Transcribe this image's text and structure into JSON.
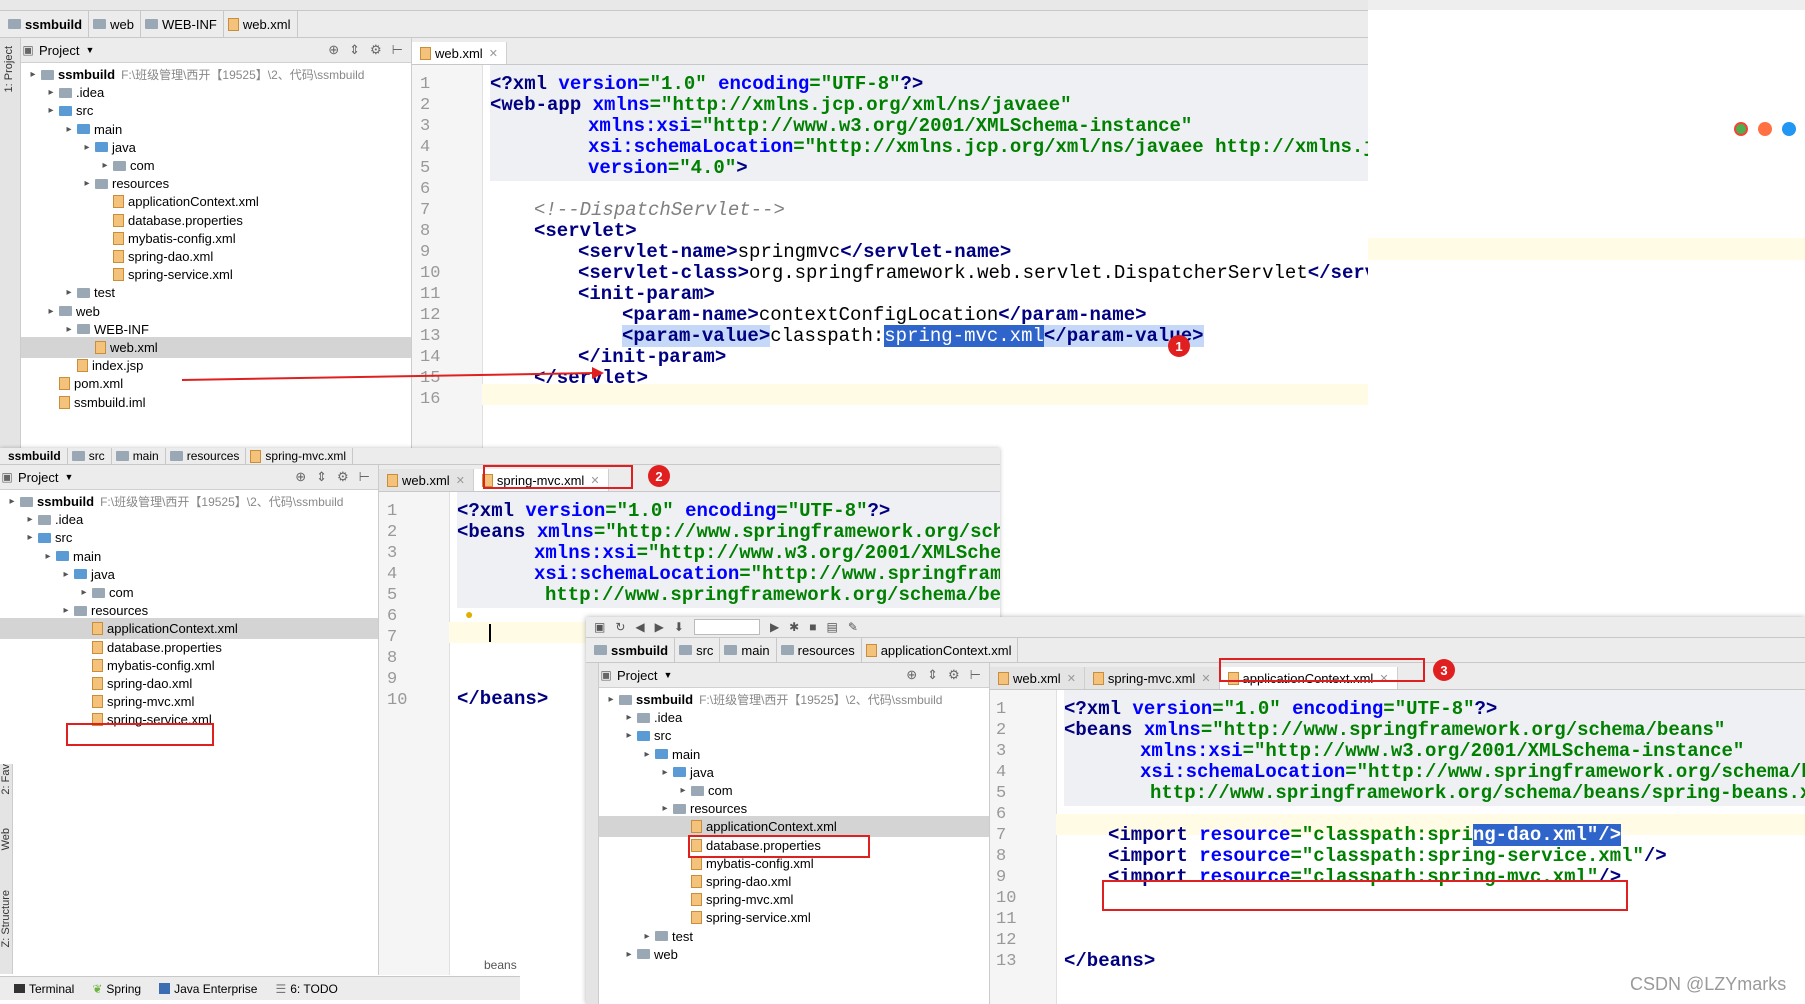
{
  "window1": {
    "breadcrumb": [
      "ssmbuild",
      "web",
      "WEB-INF",
      "web.xml"
    ],
    "project_label": "Project",
    "tree": [
      {
        "label": "ssmbuild",
        "path": "F:\\班级管理\\西开【19525】\\2、代码\\ssmbuild",
        "depth": 0
      },
      {
        "label": ".idea",
        "depth": 1
      },
      {
        "label": "src",
        "depth": 1
      },
      {
        "label": "main",
        "depth": 2
      },
      {
        "label": "java",
        "depth": 3
      },
      {
        "label": "com",
        "depth": 4
      },
      {
        "label": "resources",
        "depth": 3
      },
      {
        "label": "applicationContext.xml",
        "depth": 4
      },
      {
        "label": "database.properties",
        "depth": 4
      },
      {
        "label": "mybatis-config.xml",
        "depth": 4
      },
      {
        "label": "spring-dao.xml",
        "depth": 4
      },
      {
        "label": "spring-service.xml",
        "depth": 4
      },
      {
        "label": "test",
        "depth": 2
      },
      {
        "label": "web",
        "depth": 1
      },
      {
        "label": "WEB-INF",
        "depth": 2
      },
      {
        "label": "web.xml",
        "depth": 3
      },
      {
        "label": "index.jsp",
        "depth": 2
      },
      {
        "label": "pom.xml",
        "depth": 1
      },
      {
        "label": "ssmbuild.iml",
        "depth": 1
      }
    ],
    "tab": "web.xml",
    "line_numbers": [
      "1",
      "2",
      "3",
      "4",
      "5",
      "6",
      "7",
      "8",
      "9",
      "10",
      "11",
      "12",
      "13",
      "14",
      "15",
      "16"
    ]
  },
  "window2": {
    "breadcrumb": [
      "ssmbuild",
      "src",
      "main",
      "resources",
      "spring-mvc.xml"
    ],
    "project_label": "Project",
    "tree": [
      {
        "label": "ssmbuild",
        "path": "F:\\班级管理\\西开【19525】\\2、代码\\ssmbuild",
        "depth": 0
      },
      {
        "label": ".idea",
        "depth": 1
      },
      {
        "label": "src",
        "depth": 1
      },
      {
        "label": "main",
        "depth": 2
      },
      {
        "label": "java",
        "depth": 3
      },
      {
        "label": "com",
        "depth": 4
      },
      {
        "label": "resources",
        "depth": 3
      },
      {
        "label": "applicationContext.xml",
        "depth": 4
      },
      {
        "label": "database.properties",
        "depth": 4
      },
      {
        "label": "mybatis-config.xml",
        "depth": 4
      },
      {
        "label": "spring-dao.xml",
        "depth": 4
      },
      {
        "label": "spring-mvc.xml",
        "depth": 4
      },
      {
        "label": "spring-service.xml",
        "depth": 4
      }
    ],
    "tabs": [
      "web.xml",
      "spring-mvc.xml"
    ],
    "line_numbers": [
      "1",
      "2",
      "3",
      "4",
      "5",
      "6",
      "7",
      "8",
      "9",
      "10"
    ],
    "footer": "beans"
  },
  "window3": {
    "breadcrumb": [
      "ssmbuild",
      "src",
      "main",
      "resources",
      "applicationContext.xml"
    ],
    "project_label": "Project",
    "tree": [
      {
        "label": "ssmbuild",
        "path": "F:\\班级管理\\西开【19525】\\2、代码\\ssmbuild",
        "depth": 0
      },
      {
        "label": ".idea",
        "depth": 1
      },
      {
        "label": "src",
        "depth": 1
      },
      {
        "label": "main",
        "depth": 2
      },
      {
        "label": "java",
        "depth": 3
      },
      {
        "label": "com",
        "depth": 4
      },
      {
        "label": "resources",
        "depth": 3
      },
      {
        "label": "applicationContext.xml",
        "depth": 4
      },
      {
        "label": "database.properties",
        "depth": 4
      },
      {
        "label": "mybatis-config.xml",
        "depth": 4
      },
      {
        "label": "spring-dao.xml",
        "depth": 4
      },
      {
        "label": "spring-mvc.xml",
        "depth": 4
      },
      {
        "label": "spring-service.xml",
        "depth": 4
      },
      {
        "label": "test",
        "depth": 2
      },
      {
        "label": "web",
        "depth": 1
      }
    ],
    "tabs": [
      "web.xml",
      "spring-mvc.xml",
      "applicationContext.xml"
    ],
    "line_numbers": [
      "1",
      "2",
      "3",
      "4",
      "5",
      "6",
      "7",
      "8",
      "9",
      "10",
      "11",
      "12",
      "13"
    ]
  },
  "badges": [
    "1",
    "2",
    "3"
  ],
  "status_bar": [
    "Terminal",
    "Spring",
    "Java Enterprise",
    "6: TODO"
  ],
  "side_tabs": [
    "1: Project",
    "2: Fav",
    "Web",
    "Z: Structure"
  ],
  "watermark": "CSDN @LZYmarks",
  "colors": {
    "tag": "#000080",
    "attr": "#0000ff",
    "string": "#008000",
    "comment": "#808080",
    "selection": "#2f65ca",
    "annotation": "#e02020"
  }
}
